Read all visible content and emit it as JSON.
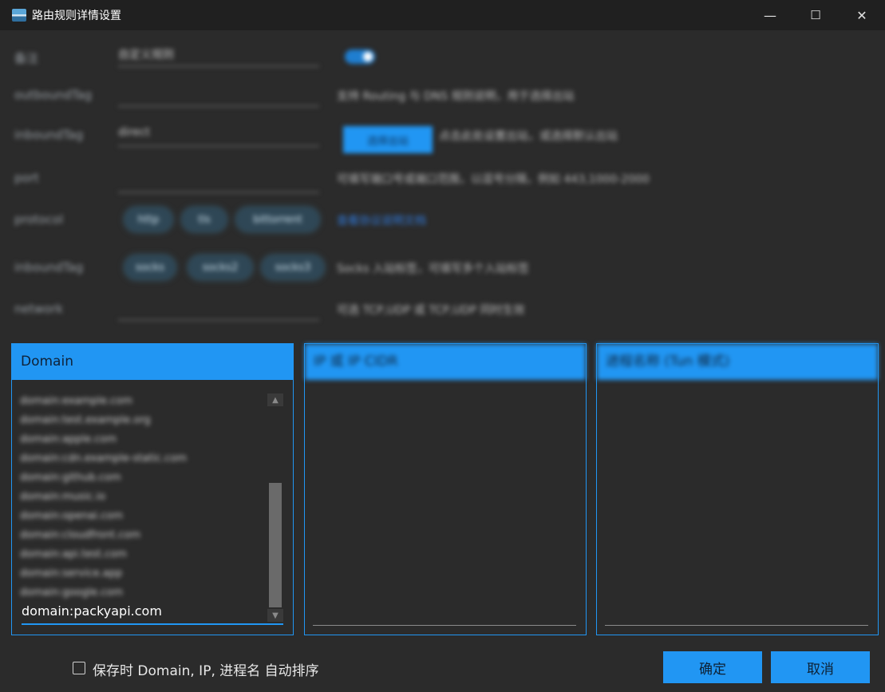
{
  "window": {
    "title": "路由规则详情设置",
    "minimize_glyph": "—",
    "maximize_glyph": "☐",
    "close_glyph": "✕",
    "app_icon": "app-window-icon"
  },
  "form": {
    "rows": [
      {
        "label": "备注",
        "value": "自定义规则"
      },
      {
        "label": "outboundTag",
        "value": ""
      },
      {
        "label": "inboundTag",
        "value": "direct"
      },
      {
        "label": "port",
        "value": ""
      },
      {
        "label": "protocol",
        "value": ""
      },
      {
        "label": "inboundTag",
        "value": ""
      },
      {
        "label": "network",
        "value": ""
      }
    ],
    "remark_desc": "",
    "outbound_desc": "支持 Routing 与 DNS 规则说明，用于选择出站",
    "inbound_button": "选择出站",
    "inbound_desc": "点击此处设置出站，或选择默认出站",
    "port_desc": "可填写端口号或端口范围，以逗号分隔，例如 443,1000-2000",
    "protocol_chips": [
      "http",
      "tls",
      "bittorrent"
    ],
    "protocol_link": "查看协议说明文档",
    "sniff_chips": [
      "socks",
      "socks2",
      "socks3"
    ],
    "sniff_desc": "Socks 入站标签，可填写多个入站标签",
    "network_desc": "可选 TCP,UDP 或 TCP,UDP 同时生效"
  },
  "panels": {
    "domain": {
      "header": "Domain",
      "items": [
        "domain:example.com",
        "domain:test.example.org",
        "domain:apple.com",
        "domain:cdn.example-static.com",
        "domain:github.com",
        "domain:music.io",
        "domain:openai.com",
        "domain:cloudfront.com",
        "domain:api.test.com",
        "domain:service.app",
        "domain:google.com",
        "domain:packyapi.com"
      ],
      "input_value": "domain:packyapi.com"
    },
    "ip": {
      "header": "IP 或 IP CIDR"
    },
    "process": {
      "header": "进程名称 (Tun 模式)"
    }
  },
  "footer": {
    "checkbox_label": "保存时 Domain, IP, 进程名 自动排序",
    "ok_button": "确定",
    "cancel_button": "取消"
  },
  "colors": {
    "accent": "#2196f3",
    "background": "#2b2b2b",
    "titlebar": "#202020"
  }
}
